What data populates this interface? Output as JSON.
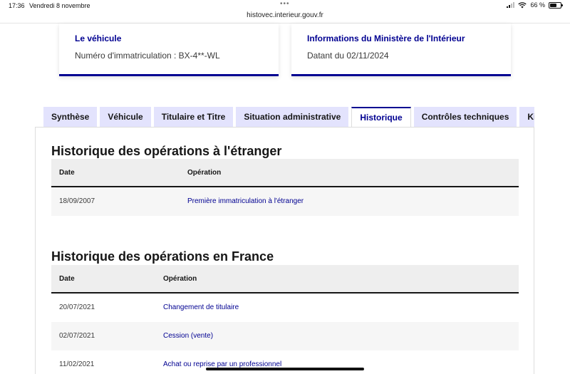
{
  "status_bar": {
    "time": "17:36",
    "date": "Vendredi 8 novembre",
    "battery": "66 %",
    "battery_level": 0.66
  },
  "browser": {
    "url": "histovec.interieur.gouv.fr"
  },
  "cards": [
    {
      "title": "Le véhicule",
      "text": "Numéro d'immatriculation : BX-4**-WL"
    },
    {
      "title": "Informations du Ministère de l'Intérieur",
      "text": "Datant du 02/11/2024"
    }
  ],
  "tabs": [
    {
      "label": "Synthèse"
    },
    {
      "label": "Véhicule"
    },
    {
      "label": "Titulaire et Titre"
    },
    {
      "label": "Situation administrative"
    },
    {
      "label": "Historique"
    },
    {
      "label": "Contrôles techniques"
    },
    {
      "label": "Kilométrage"
    }
  ],
  "active_tab": "Historique",
  "foreign": {
    "title": "Historique des opérations à l'étranger",
    "headers": {
      "date": "Date",
      "operation": "Opération"
    },
    "rows": [
      {
        "date": "18/09/2007",
        "operation": "Première immatriculation à l'étranger"
      }
    ]
  },
  "france": {
    "title": "Historique des opérations en France",
    "headers": {
      "date": "Date",
      "operation": "Opération"
    },
    "rows": [
      {
        "date": "20/07/2021",
        "operation": "Changement de titulaire"
      },
      {
        "date": "02/07/2021",
        "operation": "Cession (vente)"
      },
      {
        "date": "11/02/2021",
        "operation": "Achat ou reprise par un professionnel"
      }
    ]
  },
  "colors": {
    "accent": "#000091",
    "tab_bg": "#e3e3fd",
    "header_bg": "#eeeeee"
  }
}
